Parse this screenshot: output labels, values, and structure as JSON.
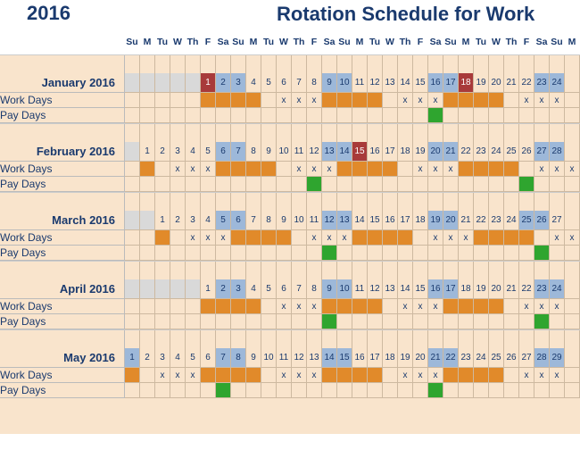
{
  "year": "2016",
  "title": "Rotation Schedule for Work",
  "dow": [
    "Su",
    "M",
    "Tu",
    "W",
    "Th",
    "F",
    "Sa",
    "Su",
    "M",
    "Tu",
    "W",
    "Th",
    "F",
    "Sa",
    "Su",
    "M",
    "Tu",
    "W",
    "Th",
    "F",
    "Sa",
    "Su",
    "M",
    "Tu",
    "W",
    "Th",
    "F",
    "Sa",
    "Su",
    "M"
  ],
  "row_labels": {
    "work": "Work Days",
    "pay": "Pay Days"
  },
  "months": [
    {
      "name": "January 2016",
      "offset": 5,
      "days": [
        {
          "n": 1,
          "c": "red"
        },
        {
          "n": 2,
          "c": "blue"
        },
        {
          "n": 3,
          "c": "blue"
        },
        {
          "n": 4
        },
        {
          "n": 5
        },
        {
          "n": 6
        },
        {
          "n": 7
        },
        {
          "n": 8
        },
        {
          "n": 9,
          "c": "blue"
        },
        {
          "n": 10,
          "c": "blue"
        },
        {
          "n": 11
        },
        {
          "n": 12
        },
        {
          "n": 13
        },
        {
          "n": 14
        },
        {
          "n": 15
        },
        {
          "n": 16,
          "c": "blue"
        },
        {
          "n": 17,
          "c": "blue"
        },
        {
          "n": 18,
          "c": "red"
        },
        {
          "n": 19
        },
        {
          "n": 20
        },
        {
          "n": 21
        },
        {
          "n": 22
        },
        {
          "n": 23,
          "c": "blue"
        },
        {
          "n": 24,
          "c": "blue"
        }
      ],
      "work": [
        "",
        "",
        "",
        "",
        "",
        "o",
        "o",
        "o",
        "o",
        "",
        "x",
        "x",
        "x",
        "o",
        "o",
        "o",
        "o",
        "",
        "x",
        "x",
        "x",
        "o",
        "o",
        "o",
        "o",
        "",
        "x",
        "x",
        "x",
        ""
      ],
      "pay": [
        "",
        "",
        "",
        "",
        "",
        "",
        "",
        "",
        "",
        "",
        "",
        "",
        "",
        "",
        "",
        "",
        "",
        "",
        "",
        "",
        "g",
        "",
        "",
        "",
        "",
        "",
        "",
        "",
        "",
        ""
      ]
    },
    {
      "name": "February 2016",
      "offset": 1,
      "days": [
        {
          "n": 1
        },
        {
          "n": 2
        },
        {
          "n": 3
        },
        {
          "n": 4
        },
        {
          "n": 5
        },
        {
          "n": 6,
          "c": "blue"
        },
        {
          "n": 7,
          "c": "blue"
        },
        {
          "n": 8
        },
        {
          "n": 9
        },
        {
          "n": 10
        },
        {
          "n": 11
        },
        {
          "n": 12
        },
        {
          "n": 13,
          "c": "blue"
        },
        {
          "n": 14,
          "c": "blue"
        },
        {
          "n": 15,
          "c": "red"
        },
        {
          "n": 16
        },
        {
          "n": 17
        },
        {
          "n": 18
        },
        {
          "n": 19
        },
        {
          "n": 20,
          "c": "blue"
        },
        {
          "n": 21,
          "c": "blue"
        },
        {
          "n": 22
        },
        {
          "n": 23
        },
        {
          "n": 24
        },
        {
          "n": 25
        },
        {
          "n": 26
        },
        {
          "n": 27,
          "c": "blue"
        },
        {
          "n": 28,
          "c": "blue"
        }
      ],
      "work": [
        "",
        "o",
        "",
        "x",
        "x",
        "x",
        "o",
        "o",
        "o",
        "o",
        "",
        "x",
        "x",
        "x",
        "o",
        "o",
        "o",
        "o",
        "",
        "x",
        "x",
        "x",
        "o",
        "o",
        "o",
        "o",
        "",
        "x",
        "x",
        "x"
      ],
      "pay": [
        "",
        "",
        "",
        "",
        "",
        "",
        "",
        "",
        "",
        "",
        "",
        "",
        "g",
        "",
        "",
        "",
        "",
        "",
        "",
        "",
        "",
        "",
        "",
        "",
        "",
        "",
        "g",
        "",
        "",
        ""
      ]
    },
    {
      "name": "March 2016",
      "offset": 2,
      "days": [
        {
          "n": 1
        },
        {
          "n": 2
        },
        {
          "n": 3
        },
        {
          "n": 4
        },
        {
          "n": 5,
          "c": "blue"
        },
        {
          "n": 6,
          "c": "blue"
        },
        {
          "n": 7
        },
        {
          "n": 8
        },
        {
          "n": 9
        },
        {
          "n": 10
        },
        {
          "n": 11
        },
        {
          "n": 12,
          "c": "blue"
        },
        {
          "n": 13,
          "c": "blue"
        },
        {
          "n": 14
        },
        {
          "n": 15
        },
        {
          "n": 16
        },
        {
          "n": 17
        },
        {
          "n": 18
        },
        {
          "n": 19,
          "c": "blue"
        },
        {
          "n": 20,
          "c": "blue"
        },
        {
          "n": 21
        },
        {
          "n": 22
        },
        {
          "n": 23
        },
        {
          "n": 24
        },
        {
          "n": 25,
          "c": "blue"
        },
        {
          "n": 26,
          "c": "blue"
        },
        {
          "n": 27
        }
      ],
      "work": [
        "",
        "",
        "o",
        "",
        "x",
        "x",
        "x",
        "o",
        "o",
        "o",
        "o",
        "",
        "x",
        "x",
        "x",
        "o",
        "o",
        "o",
        "o",
        "",
        "x",
        "x",
        "x",
        "o",
        "o",
        "o",
        "o",
        "",
        "x",
        "x"
      ],
      "pay": [
        "",
        "",
        "",
        "",
        "",
        "",
        "",
        "",
        "",
        "",
        "",
        "",
        "",
        "g",
        "",
        "",
        "",
        "",
        "",
        "",
        "",
        "",
        "",
        "",
        "",
        "",
        "",
        "g",
        "",
        ""
      ]
    },
    {
      "name": "April 2016",
      "offset": 5,
      "days": [
        {
          "n": 1
        },
        {
          "n": 2,
          "c": "blue"
        },
        {
          "n": 3,
          "c": "blue"
        },
        {
          "n": 4
        },
        {
          "n": 5
        },
        {
          "n": 6
        },
        {
          "n": 7
        },
        {
          "n": 8
        },
        {
          "n": 9,
          "c": "blue"
        },
        {
          "n": 10,
          "c": "blue"
        },
        {
          "n": 11
        },
        {
          "n": 12
        },
        {
          "n": 13
        },
        {
          "n": 14
        },
        {
          "n": 15
        },
        {
          "n": 16,
          "c": "blue"
        },
        {
          "n": 17,
          "c": "blue"
        },
        {
          "n": 18
        },
        {
          "n": 19
        },
        {
          "n": 20
        },
        {
          "n": 21
        },
        {
          "n": 22
        },
        {
          "n": 23,
          "c": "blue"
        },
        {
          "n": 24,
          "c": "blue"
        }
      ],
      "work": [
        "",
        "",
        "",
        "",
        "",
        "o",
        "o",
        "o",
        "o",
        "",
        "x",
        "x",
        "x",
        "o",
        "o",
        "o",
        "o",
        "",
        "x",
        "x",
        "x",
        "o",
        "o",
        "o",
        "o",
        "",
        "x",
        "x",
        "x",
        ""
      ],
      "pay": [
        "",
        "",
        "",
        "",
        "",
        "",
        "",
        "",
        "",
        "",
        "",
        "",
        "",
        "g",
        "",
        "",
        "",
        "",
        "",
        "",
        "",
        "",
        "",
        "",
        "",
        "",
        "",
        "g",
        "",
        ""
      ]
    },
    {
      "name": "May 2016",
      "offset": 0,
      "days": [
        {
          "n": 1,
          "c": "blue"
        },
        {
          "n": 2
        },
        {
          "n": 3
        },
        {
          "n": 4
        },
        {
          "n": 5
        },
        {
          "n": 6
        },
        {
          "n": 7,
          "c": "blue"
        },
        {
          "n": 8,
          "c": "blue"
        },
        {
          "n": 9
        },
        {
          "n": 10
        },
        {
          "n": 11
        },
        {
          "n": 12
        },
        {
          "n": 13
        },
        {
          "n": 14,
          "c": "blue"
        },
        {
          "n": 15,
          "c": "blue"
        },
        {
          "n": 16
        },
        {
          "n": 17
        },
        {
          "n": 18
        },
        {
          "n": 19
        },
        {
          "n": 20
        },
        {
          "n": 21,
          "c": "blue"
        },
        {
          "n": 22,
          "c": "blue"
        },
        {
          "n": 23
        },
        {
          "n": 24
        },
        {
          "n": 25
        },
        {
          "n": 26
        },
        {
          "n": 27
        },
        {
          "n": 28,
          "c": "blue"
        },
        {
          "n": 29,
          "c": "blue"
        }
      ],
      "work": [
        "o",
        "",
        "x",
        "x",
        "x",
        "o",
        "o",
        "o",
        "o",
        "",
        "x",
        "x",
        "x",
        "o",
        "o",
        "o",
        "o",
        "",
        "x",
        "x",
        "x",
        "o",
        "o",
        "o",
        "o",
        "",
        "x",
        "x",
        "x",
        ""
      ],
      "pay": [
        "",
        "",
        "",
        "",
        "",
        "",
        "g",
        "",
        "",
        "",
        "",
        "",
        "",
        "",
        "",
        "",
        "",
        "",
        "",
        "",
        "g",
        "",
        "",
        "",
        "",
        "",
        "",
        "",
        "",
        ""
      ]
    }
  ]
}
